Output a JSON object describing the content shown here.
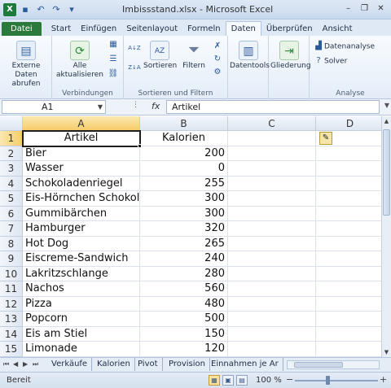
{
  "window": {
    "title": "Imbissstand.xlsx - Microsoft Excel"
  },
  "tabs": [
    "Datei",
    "Start",
    "Einfügen",
    "Seitenlayout",
    "Formeln",
    "Daten",
    "Überprüfen",
    "Ansicht"
  ],
  "active_tab": "Daten",
  "ribbon": {
    "extern_label": "Externe Daten abrufen",
    "refresh_label": "Alle aktualisieren",
    "group_verbindungen": "Verbindungen",
    "sort_label": "Sortieren",
    "filter_label": "Filtern",
    "group_sortfilter": "Sortieren und Filtern",
    "datentools_label": "Datentools",
    "gliederung_label": "Gliederung",
    "datenanalyse_label": "Datenanalyse",
    "solver_label": "Solver",
    "group_analyse": "Analyse",
    "sort_az_icon": "A↓Z",
    "sort_za_icon": "Z↓A"
  },
  "formula_bar": {
    "name_box": "A1",
    "fx": "fx",
    "formula": "Artikel"
  },
  "columns": [
    "A",
    "B",
    "C",
    "D"
  ],
  "rows": [
    {
      "n": "1",
      "a": "Artikel",
      "b": "Kalorien"
    },
    {
      "n": "2",
      "a": "Bier",
      "b": "200"
    },
    {
      "n": "3",
      "a": "Wasser",
      "b": "0"
    },
    {
      "n": "4",
      "a": "Schokoladenriegel",
      "b": "255"
    },
    {
      "n": "5",
      "a": "Eis-Hörnchen Schokolade",
      "b": "300"
    },
    {
      "n": "6",
      "a": "Gummibärchen",
      "b": "300"
    },
    {
      "n": "7",
      "a": "Hamburger",
      "b": "320"
    },
    {
      "n": "8",
      "a": "Hot Dog",
      "b": "265"
    },
    {
      "n": "9",
      "a": "Eiscreme-Sandwich",
      "b": "240"
    },
    {
      "n": "10",
      "a": "Lakritzschlange",
      "b": "280"
    },
    {
      "n": "11",
      "a": "Nachos",
      "b": "560"
    },
    {
      "n": "12",
      "a": "Pizza",
      "b": "480"
    },
    {
      "n": "13",
      "a": "Popcorn",
      "b": "500"
    },
    {
      "n": "14",
      "a": "Eis am Stiel",
      "b": "150"
    },
    {
      "n": "15",
      "a": "Limonade",
      "b": "120"
    }
  ],
  "sheets": [
    "Verkäufe",
    "Kalorien",
    "Pivot",
    "Provision",
    "Einnahmen je Ar"
  ],
  "status": {
    "ready": "Bereit",
    "zoom": "100 %"
  }
}
